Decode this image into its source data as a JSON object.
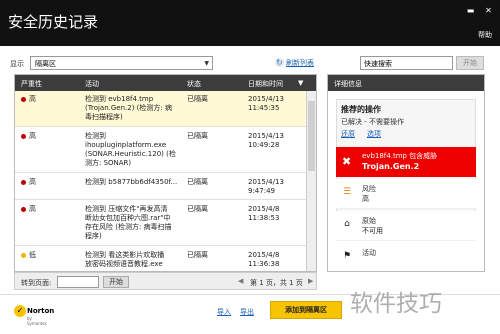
{
  "window": {
    "title": "安全历史记录",
    "help": "帮助",
    "minimize_icon": "minimize-icon",
    "close_icon": "close-icon"
  },
  "toolbar": {
    "show_label": "显示",
    "filter_value": "隔离区",
    "refresh_label": "刷新列表",
    "search_placeholder": "快速搜索",
    "start_label": "开始"
  },
  "table": {
    "headers": [
      "严重性",
      "活动",
      "状态",
      "日期和时间"
    ],
    "sort_indicator": "▼",
    "rows": [
      {
        "severity": "高",
        "severity_color": "#c00000",
        "activity": [
          "检测到 evb18f4.tmp",
          "(Trojan.Gen.2) (检测方: 病",
          "毒扫描程序)"
        ],
        "status": "已隔离",
        "date": "2015/4/13",
        "time": "11:45:35"
      },
      {
        "severity": "高",
        "severity_color": "#c00000",
        "activity": [
          "检测到",
          "ihoupluginplatform.exe",
          "(SONAR.Heuristic.120) (检",
          "测方: SONAR)"
        ],
        "status": "已隔离",
        "date": "2015/4/13",
        "time": "10:49:28"
      },
      {
        "severity": "高",
        "severity_color": "#c00000",
        "activity": [
          "检测到 b5877bb6df4350f..."
        ],
        "status": "已隔离",
        "date": "2015/4/13",
        "time": "9:47:49"
      },
      {
        "severity": "高",
        "severity_color": "#c00000",
        "activity": [
          "检测到 压缩文件\"再发高清",
          "断幼女包加百种六图.rar\"中",
          "存在风险 (检测方: 病毒扫描",
          "程序)"
        ],
        "status": "已隔离",
        "date": "2015/4/8",
        "time": "11:38:53"
      },
      {
        "severity": "低",
        "severity_color": "#f0b400",
        "activity": [
          "检测到 看这类影片欢取播",
          "放密码视频语音教程.exe"
        ],
        "status": "已隔离",
        "date": "2015/4/8",
        "time": "11:36:38"
      }
    ]
  },
  "pager": {
    "goto_label": "转到页面:",
    "go_label": "开始",
    "page_info": "第 1 页，共 1 页",
    "prev": "◀",
    "next": "▶"
  },
  "detail": {
    "header": "详细信息",
    "recommended_title": "推荐的操作",
    "recommended_sub": "已解决 - 不需要操作",
    "restore_link": "还原",
    "options_link": "选项",
    "threat_line1": "evb18f4.tmp 包含威胁",
    "threat_line2": "Trojan.Gen.2",
    "rows": [
      {
        "key": "风险",
        "value": "高",
        "icon": "risk-bars-icon"
      },
      {
        "key": "原始",
        "value": "不可用",
        "icon": "home-icon"
      },
      {
        "key": "活动",
        "value": "",
        "icon": "flag-icon"
      }
    ]
  },
  "footer": {
    "brand": "Norton",
    "brand_sub": "by Symantec",
    "import_link": "导入",
    "export_link": "导出",
    "add_button": "添加到隔离区"
  },
  "watermark": "软件技巧"
}
